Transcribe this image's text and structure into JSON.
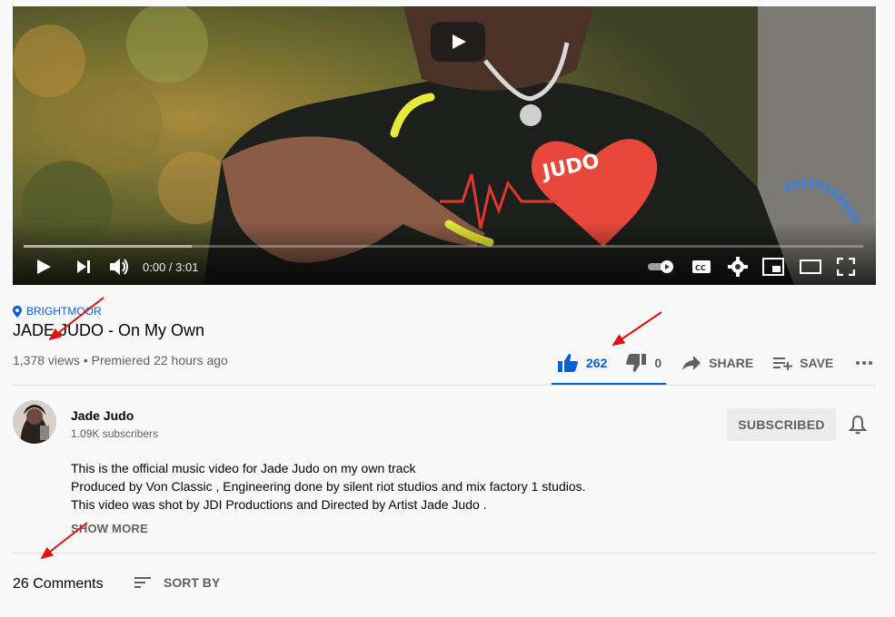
{
  "player": {
    "time": "0:00 / 3:01",
    "progress_loaded_fraction": 0.2,
    "progress_played_fraction": 0.0,
    "icons": [
      "play-icon",
      "next-icon",
      "volume-icon",
      "autoplay-toggle-icon",
      "captions-icon",
      "settings-icon",
      "miniplayer-icon",
      "theater-icon",
      "fullscreen-icon"
    ],
    "shirt_text": "JUDO"
  },
  "video": {
    "location": "BRIGHTMOOR",
    "title": "JADE JUDO - On My Own",
    "views": "1,378 views",
    "separator": "•",
    "premiered": "Premiered 22 hours ago"
  },
  "actions": {
    "like_count": "262",
    "dislike_count": "0",
    "share_label": "SHARE",
    "save_label": "SAVE",
    "like_color": "#065fd4"
  },
  "channel": {
    "name": "Jade Judo",
    "subscribers": "1.09K subscribers",
    "subscribe_label": "SUBSCRIBED"
  },
  "description": {
    "lines": [
      "This is the official music video for Jade Judo on my own track",
      "Produced by Von Classic , Engineering done by silent riot studios and mix factory 1 studios.",
      "This video was shot by JDI Productions and Directed by Artist Jade Judo ."
    ],
    "show_more": "SHOW MORE"
  },
  "comments": {
    "count": "26 Comments",
    "sort_label": "SORT BY"
  },
  "annotations": {
    "arrow_color": "#e01010"
  }
}
